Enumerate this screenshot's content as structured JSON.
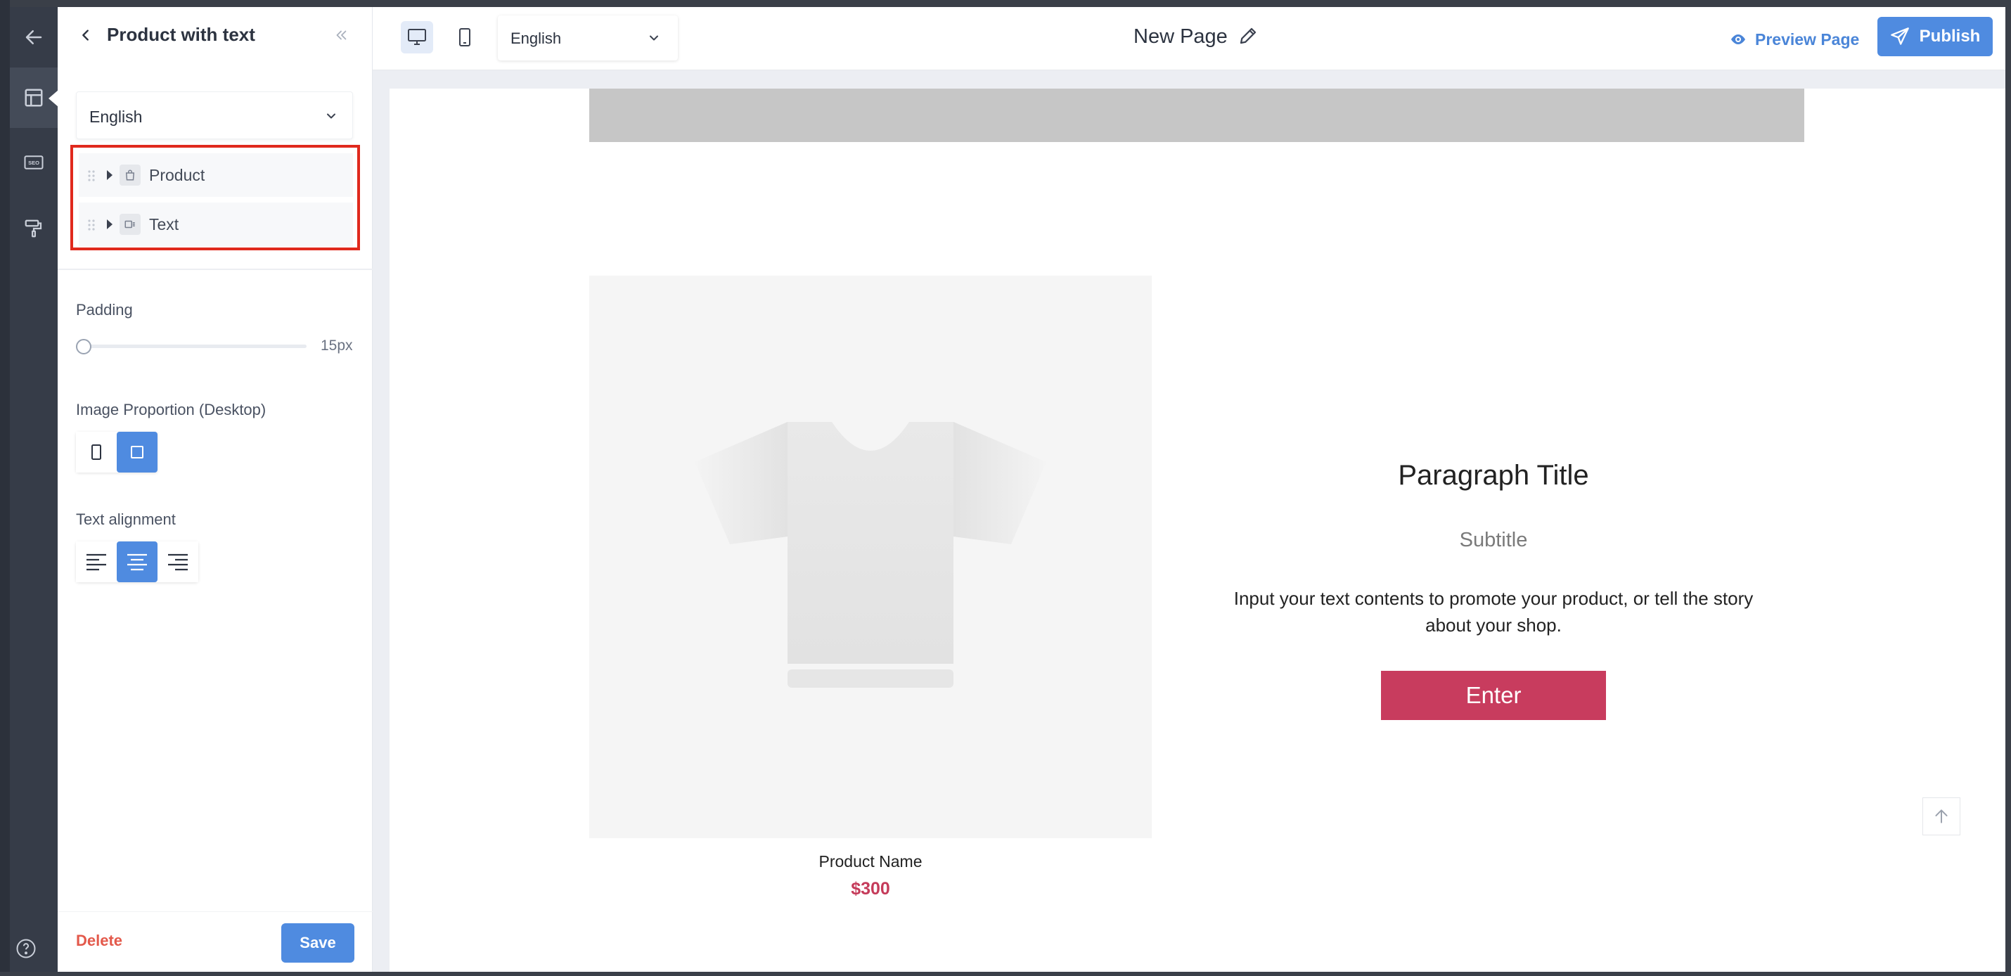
{
  "sidebar": {
    "title": "Product with text",
    "language": "English",
    "tree": [
      {
        "label": "Product",
        "icon": "shopping-bag-icon"
      },
      {
        "label": "Text",
        "icon": "text-block-icon"
      }
    ],
    "padding_label": "Padding",
    "padding_value": "15px",
    "image_proportion_label": "Image Proportion (Desktop)",
    "text_alignment_label": "Text alignment",
    "image_proportion_selected": "square",
    "text_alignment_selected": "center",
    "delete_label": "Delete",
    "save_label": "Save"
  },
  "rail": {
    "items": [
      "back-arrow-icon",
      "layout-icon",
      "seo-icon",
      "paint-roller-icon"
    ],
    "active": "layout-icon",
    "help": "help-icon"
  },
  "topbar": {
    "device_selected": "desktop",
    "language": "English",
    "page_name": "New Page",
    "preview_label": "Preview Page",
    "publish_label": "Publish"
  },
  "canvas": {
    "product_name": "Product Name",
    "product_price": "$300",
    "paragraph_title": "Paragraph Title",
    "subtitle": "Subtitle",
    "body": "Input your text contents to promote your product, or tell the story about your shop.",
    "button_label": "Enter"
  },
  "colors": {
    "accent": "#4f8be0",
    "brand_button": "#c83c5e",
    "price": "#c53b5a",
    "highlight_border": "#e0291d"
  }
}
